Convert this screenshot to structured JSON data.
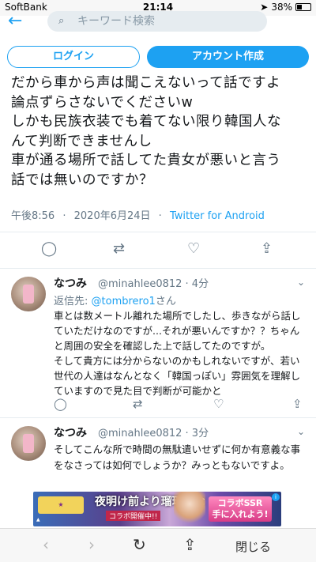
{
  "status_bar": {
    "carrier": "SoftBank",
    "time": "21:14",
    "battery": "38%",
    "battery_level": 0.38
  },
  "header": {
    "search_placeholder": "キーワード検索"
  },
  "buttons": {
    "login": "ログイン",
    "signup": "アカウント作成"
  },
  "main_tweet": {
    "text": "だから車から声は聞こえないって話ですよ\n論点ずらさないでくださいw\nしかも民族衣装でも着てない限り韓国人な\nんて判断できませんし\n車が通る場所で話してた貴女が悪いと言う\n話では無いのですか？",
    "time": "午後8:56",
    "date": "2020年6月24日",
    "separator": "·",
    "source": "Twitter for Android"
  },
  "replies": [
    {
      "name": "なつみ",
      "handle": "@minahlee0812 · 4分",
      "reply_to_prefix": "返信先: ",
      "reply_to_mention": "@tombrero1",
      "reply_to_suffix": "さん",
      "text": "車とは数メートル離れた場所でしたし、歩きながら話し\nていただけなのですが...それが悪いんですか？？ちゃん\nと周囲の安全を確認した上で話してたのですが。\nそして貴方には分からないのかもしれないですが、若い\n世代の人達はなんとなく「韓国っぽい」雰囲気を理解し\nていますので見た目で判断が可能かと"
    },
    {
      "name": "なつみ",
      "handle": "@minahlee0812 · 3分",
      "reply_to_prefix": "",
      "reply_to_mention": "",
      "reply_to_suffix": "",
      "text": "そしてこんな所で時間の無駄遣いせずに何か有意義な事\nをなさっては如何でしょうか？みっともないですよ。"
    }
  ],
  "ad": {
    "title": "夜明け前より瑠璃色な",
    "subtitle": "コラボ開催中!!",
    "collab_label": "コラボSSR\n手に入れよう!",
    "info": "i"
  },
  "bottom_bar": {
    "close_label": "閉じる"
  },
  "icons": {
    "back": "arrow-left-icon",
    "search": "search-icon",
    "reply": "comment-icon",
    "retweet": "retweet-icon",
    "like": "heart-icon",
    "share": "share-icon"
  },
  "colors": {
    "accent": "#1da1f2",
    "muted": "#657786"
  }
}
